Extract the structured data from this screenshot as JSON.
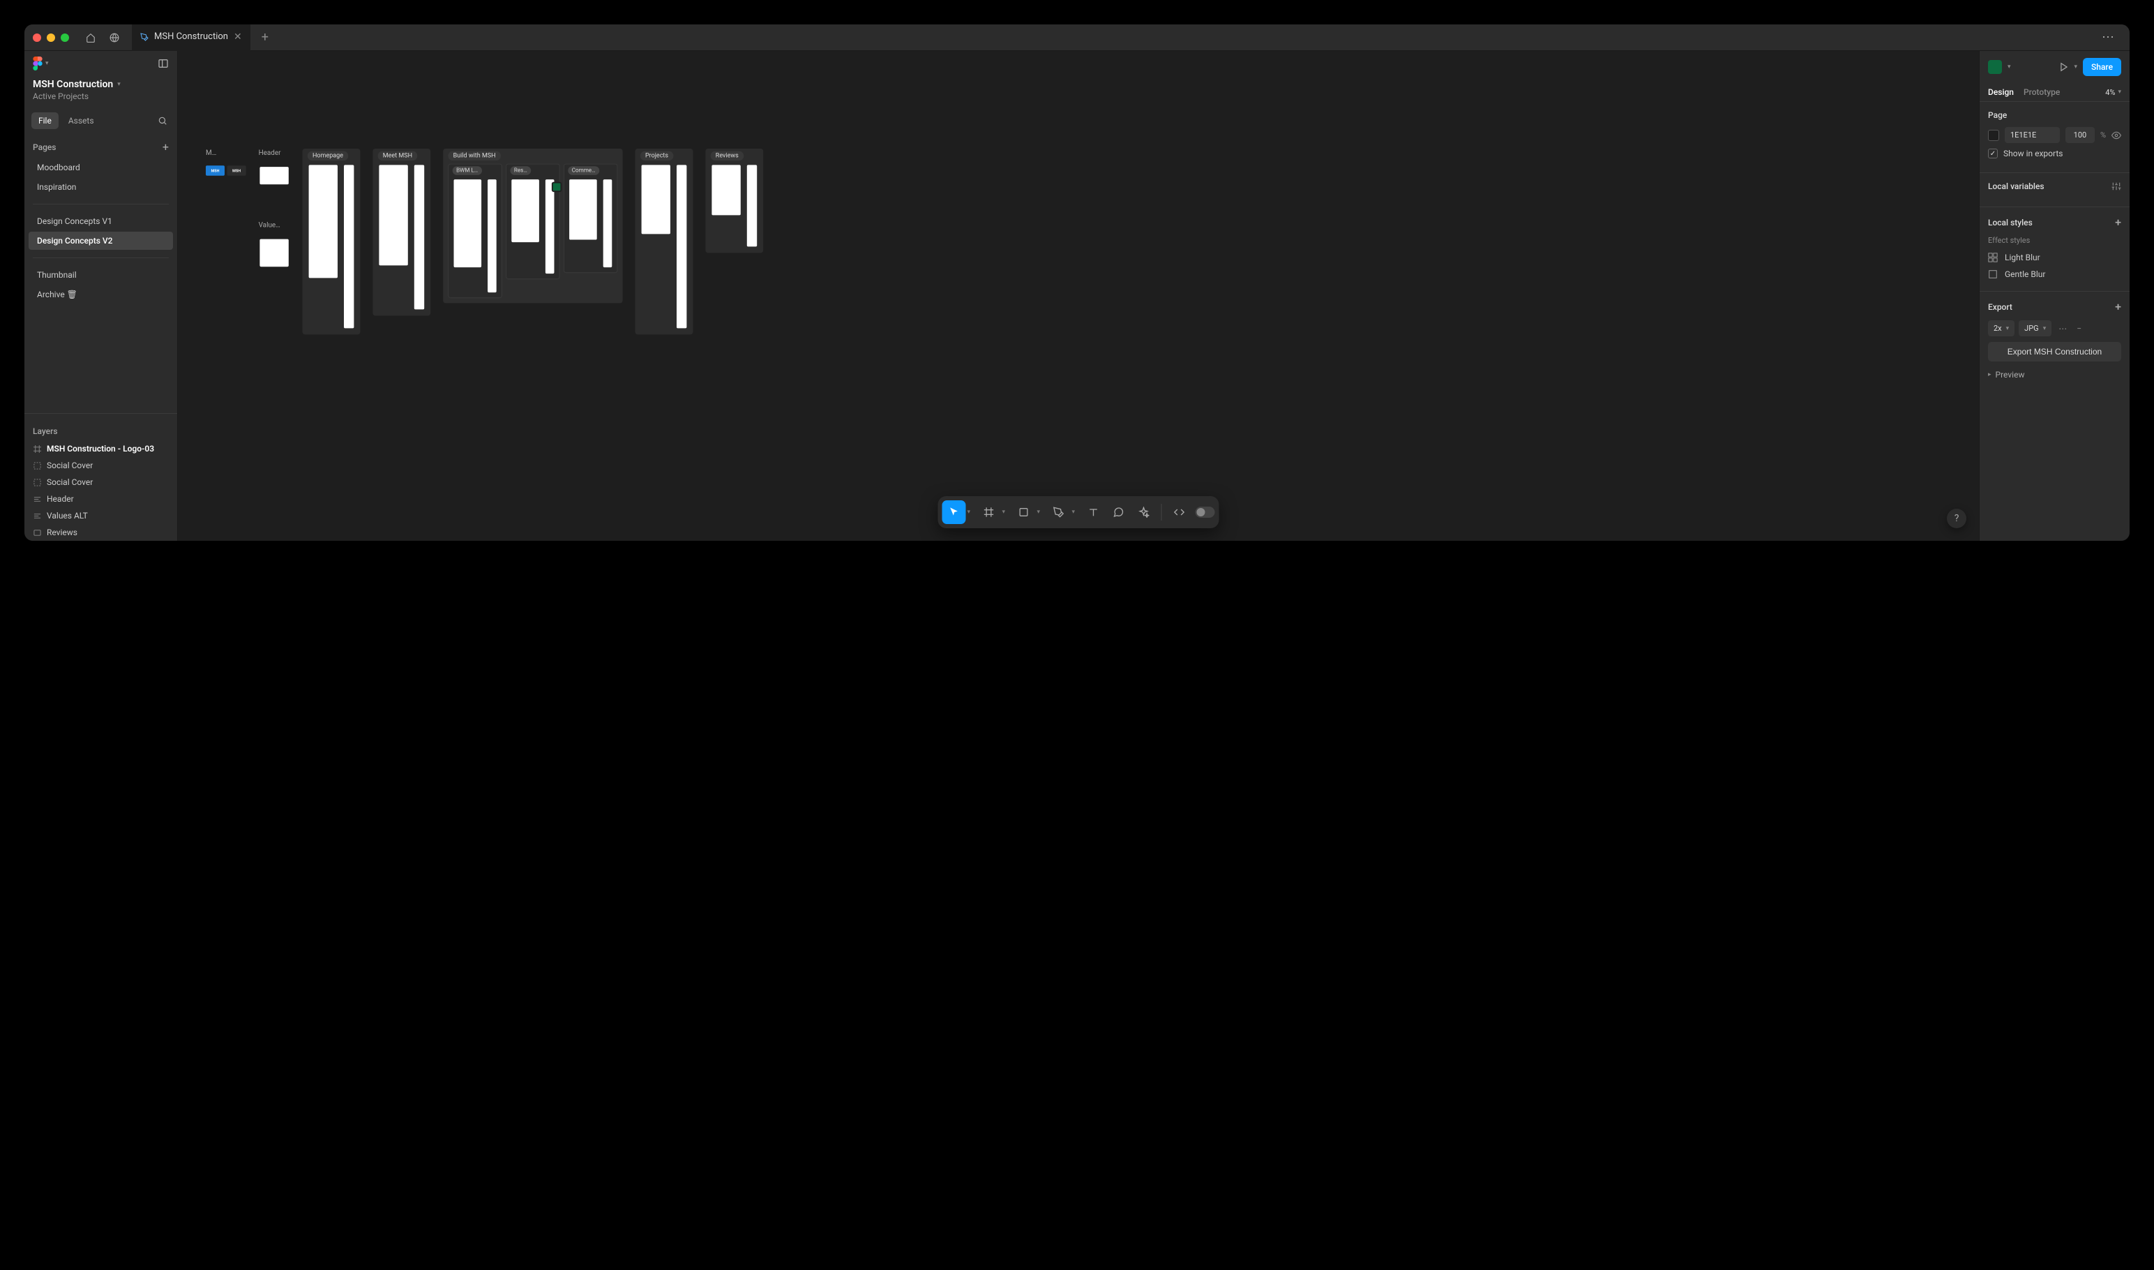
{
  "tab": {
    "title": "MSH Construction"
  },
  "left": {
    "title": "MSH Construction",
    "subtitle": "Active Projects",
    "tabs": {
      "file": "File",
      "assets": "Assets"
    },
    "pages_header": "Pages",
    "pages": [
      {
        "label": "Moodboard"
      },
      {
        "label": "Inspiration"
      }
    ],
    "pages2": [
      {
        "label": "Design Concepts V1"
      },
      {
        "label": "Design Concepts V2",
        "selected": true
      }
    ],
    "pages3": [
      {
        "label": "Thumbnail"
      },
      {
        "label": "Archive 🗑"
      }
    ],
    "layers_header": "Layers",
    "layers": [
      {
        "label": "MSH Construction - Logo-03",
        "icon": "frame",
        "bold": true
      },
      {
        "label": "Social Cover",
        "icon": "slice"
      },
      {
        "label": "Social Cover",
        "icon": "slice"
      },
      {
        "label": "Header",
        "icon": "component"
      },
      {
        "label": "Values ALT",
        "icon": "component"
      },
      {
        "label": "Reviews",
        "icon": "instance"
      }
    ]
  },
  "canvas": {
    "frames": {
      "logo_truncated": "M…",
      "logo_text": "MSH",
      "header": "Header",
      "values": "Value…",
      "homepage": "Homepage",
      "meet": "Meet MSH",
      "build": "Build with MSH",
      "build_sub1": "BWM L…",
      "build_sub2": "Res…",
      "build_sub3": "Comme…",
      "projects": "Projects",
      "reviews": "Reviews"
    }
  },
  "right": {
    "share": "Share",
    "tabs": {
      "design": "Design",
      "prototype": "Prototype"
    },
    "zoom": "4%",
    "page": {
      "title": "Page",
      "bg_hex": "1E1E1E",
      "bg_opacity": "100",
      "bg_unit": "%",
      "show_exports": "Show in exports"
    },
    "local_variables": "Local variables",
    "local_styles": {
      "title": "Local styles",
      "effect_header": "Effect styles",
      "styles": [
        {
          "label": "Light Blur"
        },
        {
          "label": "Gentle Blur"
        }
      ]
    },
    "export": {
      "title": "Export",
      "scale": "2x",
      "format": "JPG",
      "button": "Export MSH Construction",
      "preview": "Preview"
    }
  }
}
